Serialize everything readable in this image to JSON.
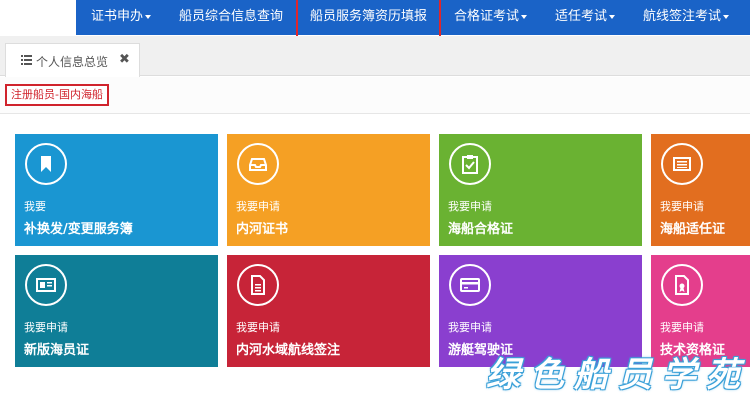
{
  "nav": {
    "items": [
      {
        "label": "证书申办",
        "dropdown": true
      },
      {
        "label": "船员综合信息查询",
        "dropdown": false
      },
      {
        "label": "船员服务簿资历填报",
        "dropdown": false
      },
      {
        "label": "合格证考试",
        "dropdown": true
      },
      {
        "label": "适任考试",
        "dropdown": true
      },
      {
        "label": "航线签注考试",
        "dropdown": true
      }
    ]
  },
  "tab": {
    "label": "个人信息总览",
    "icon": "list-icon",
    "close_icon": "close-icon"
  },
  "crumb": {
    "label": "注册船员-国内海船"
  },
  "tiles": [
    {
      "line1": "我要",
      "line2": "补换发/变更服务簿",
      "color": "#1a96d2",
      "icon": "bookmark-icon"
    },
    {
      "line1": "我要申请",
      "line2": "内河证书",
      "color": "#f5a024",
      "icon": "inbox-icon"
    },
    {
      "line1": "我要申请",
      "line2": "海船合格证",
      "color": "#6ab232",
      "icon": "clipboard-check-icon"
    },
    {
      "line1": "我要申请",
      "line2": "海船适任证",
      "color": "#e26e1f",
      "icon": "list-box-icon"
    },
    {
      "line1": "我要申请",
      "line2": "新版海员证",
      "color": "#0f7e97",
      "icon": "id-card-icon"
    },
    {
      "line1": "我要申请",
      "line2": "内河水域航线签注",
      "color": "#c72438",
      "icon": "document-icon"
    },
    {
      "line1": "我要申请",
      "line2": "游艇驾驶证",
      "color": "#8a3fcf",
      "icon": "credit-card-icon"
    },
    {
      "line1": "我要申请",
      "line2": "技术资格证",
      "color": "#e43e8c",
      "icon": "certificate-icon"
    }
  ],
  "watermark": {
    "text": "绿色船员学苑"
  },
  "colors": {
    "nav_bg": "#1a63c7",
    "highlight": "#e0262b",
    "crumb": "#d0232c"
  }
}
